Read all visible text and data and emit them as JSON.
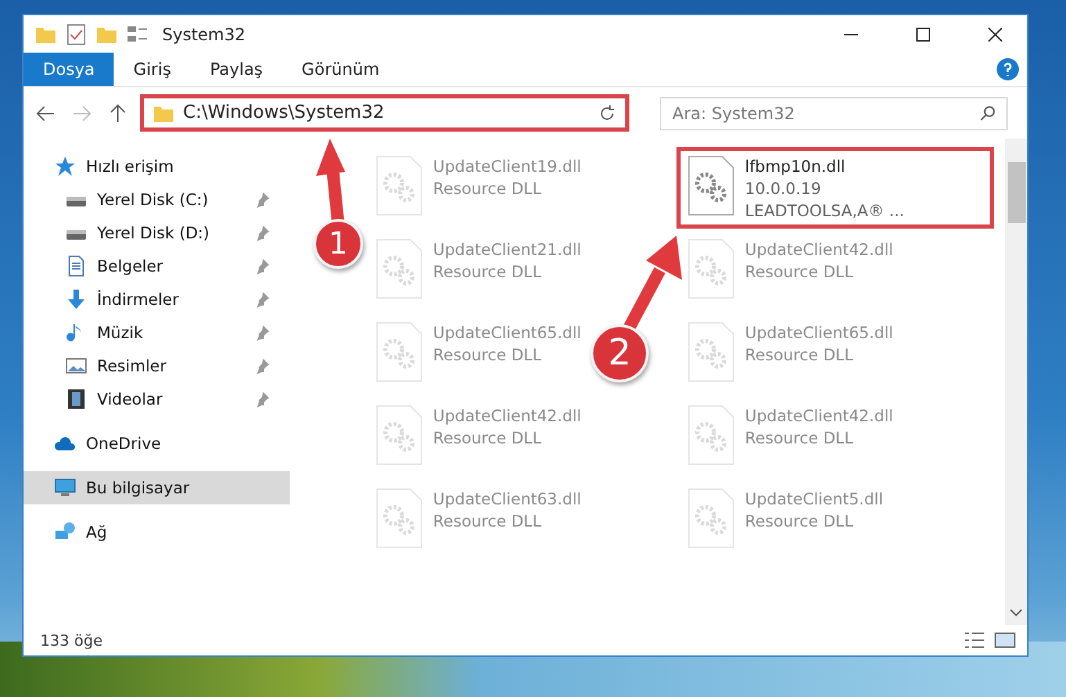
{
  "window": {
    "title": "System32"
  },
  "ribbon_tabs": [
    {
      "label": "Dosya",
      "selected": true
    },
    {
      "label": "Giriş",
      "selected": false
    },
    {
      "label": "Paylaş",
      "selected": false
    },
    {
      "label": "Görünüm",
      "selected": false
    }
  ],
  "address_bar": {
    "value": "C:\\Windows\\System32",
    "highlighted": true
  },
  "search": {
    "placeholder": "Ara: System32"
  },
  "sidebar": {
    "items": [
      {
        "label": "Hızlı erişim",
        "kind": "quick",
        "selected": false,
        "children": [
          {
            "label": "Yerel Disk (C:)",
            "kind": "drive",
            "pinned": true,
            "selected": false
          },
          {
            "label": "Yerel Disk (D:)",
            "kind": "drive",
            "pinned": true,
            "selected": false
          },
          {
            "label": "Belgeler",
            "kind": "document",
            "pinned": true,
            "selected": false
          },
          {
            "label": "İndirmeler",
            "kind": "download",
            "pinned": true,
            "selected": false
          },
          {
            "label": "Müzik",
            "kind": "music",
            "pinned": true,
            "selected": false
          },
          {
            "label": "Resimler",
            "kind": "picture",
            "pinned": true,
            "selected": false
          },
          {
            "label": "Videolar",
            "kind": "video",
            "pinned": true,
            "selected": false
          }
        ]
      },
      {
        "label": "OneDrive",
        "kind": "cloud",
        "selected": false
      },
      {
        "label": "Bu bilgisayar",
        "kind": "computer",
        "selected": true
      },
      {
        "label": "Ağ",
        "kind": "network",
        "selected": false
      }
    ]
  },
  "files": [
    {
      "name": "UpdateClient19.dll",
      "line_2": "Resource DLL",
      "highlighted": false
    },
    {
      "name": "lfbmp10n.dll",
      "line_2": "10.0.0.19",
      "line_3": "LEADTOOLSA,A®  ...",
      "highlighted": true
    },
    {
      "name": "UpdateClient21.dll",
      "line_2": "Resource DLL",
      "highlighted": false
    },
    {
      "name": "UpdateClient42.dll",
      "line_2": "Resource DLL",
      "highlighted": false
    },
    {
      "name": "UpdateClient65.dll",
      "line_2": "Resource DLL",
      "highlighted": false
    },
    {
      "name": "UpdateClient65.dll",
      "line_2": "Resource DLL",
      "highlighted": false
    },
    {
      "name": "UpdateClient42.dll",
      "line_2": "Resource DLL",
      "highlighted": false
    },
    {
      "name": "UpdateClient42.dll",
      "line_2": "Resource DLL",
      "highlighted": false
    },
    {
      "name": "UpdateClient63.dll",
      "line_2": "Resource DLL",
      "highlighted": false
    },
    {
      "name": "UpdateClient5.dll",
      "line_2": "Resource DLL",
      "highlighted": false
    }
  ],
  "status_bar": {
    "item_count": "133 öğe"
  },
  "annotations": [
    {
      "number": "1"
    },
    {
      "number": "2"
    }
  ]
}
